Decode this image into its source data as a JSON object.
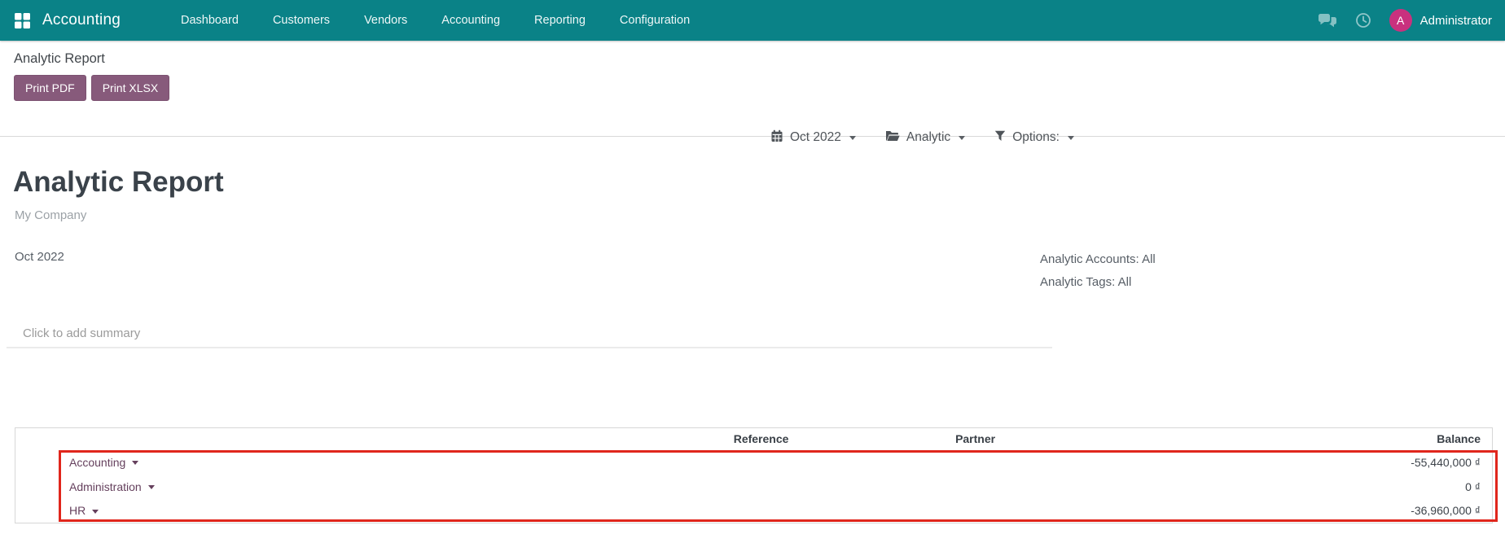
{
  "navbar": {
    "brand": "Accounting",
    "menu": [
      "Dashboard",
      "Customers",
      "Vendors",
      "Accounting",
      "Reporting",
      "Configuration"
    ],
    "user": {
      "initial": "A",
      "name": "Administrator"
    }
  },
  "control_panel": {
    "breadcrumb": "Analytic Report",
    "buttons": [
      {
        "label": "Print PDF"
      },
      {
        "label": "Print XLSX"
      }
    ],
    "filters": [
      {
        "icon": "calendar-icon",
        "label": "Oct 2022"
      },
      {
        "icon": "folder-open-icon",
        "label": "Analytic"
      },
      {
        "icon": "filter-icon",
        "label": "Options:"
      }
    ]
  },
  "report": {
    "title": "Analytic Report",
    "company": "My Company",
    "period": "Oct 2022",
    "meta_lines": [
      "Analytic Accounts: All",
      "Analytic Tags: All"
    ],
    "summary_placeholder": "Click to add summary"
  },
  "table": {
    "headers": {
      "reference": "Reference",
      "partner": "Partner",
      "balance": "Balance"
    },
    "rows": [
      {
        "name": "Accounting",
        "reference": "",
        "partner": "",
        "balance": "-55,440,000 ₫"
      },
      {
        "name": "Administration",
        "reference": "",
        "partner": "",
        "balance": "0 ₫"
      },
      {
        "name": "HR",
        "reference": "",
        "partner": "",
        "balance": "-36,960,000 ₫"
      }
    ]
  },
  "colors": {
    "navbar_teal": "#0a8287",
    "button_purple": "#875a7b",
    "avatar_pink": "#c9317e",
    "row_link_purple": "#65405d",
    "highlight_red": "#e0261c"
  }
}
